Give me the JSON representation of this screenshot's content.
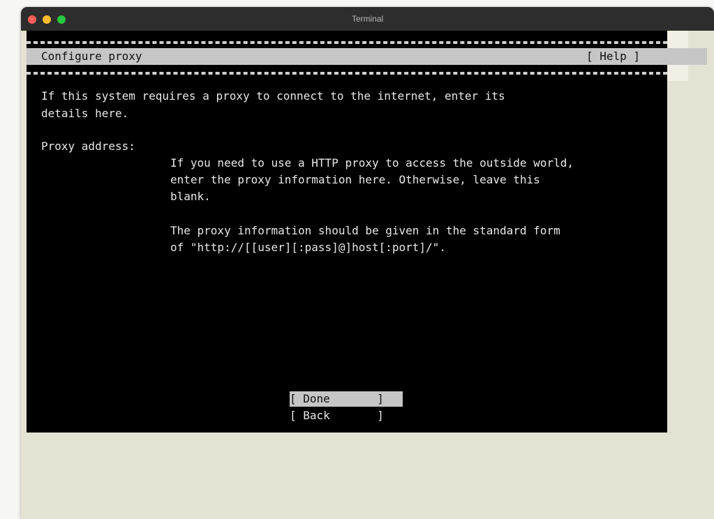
{
  "window": {
    "title": "Terminal"
  },
  "installer": {
    "title": "Configure proxy",
    "help_label": "[ Help ]",
    "intro_line1": "If this system requires a proxy to connect to the internet, enter its",
    "intro_line2": "details here.",
    "field_label": "Proxy address:",
    "description": [
      "If you need to use a HTTP proxy to access the outside world,",
      "enter the proxy information here. Otherwise, leave this",
      "blank.",
      "",
      "The proxy information should be given in the standard form",
      "of \"http://[[user][:pass]@]host[:port]/\"."
    ],
    "buttons": {
      "done_label": "[ Done       ]",
      "back_label": "[ Back       ]"
    }
  },
  "colors": {
    "terminal_bg": "#000000",
    "terminal_fg": "#e8e8e8",
    "highlight_bg": "#c6c6c6",
    "titlebar_bg": "#2d2d2d",
    "window_bg": "#e4e2d2"
  }
}
